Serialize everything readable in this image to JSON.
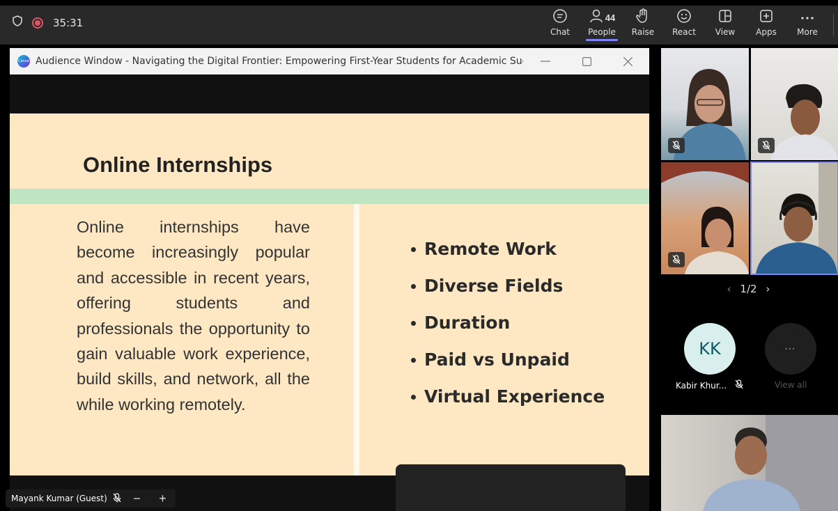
{
  "meeting": {
    "timer": "35:31"
  },
  "toolbar": {
    "chat_label": "Chat",
    "people_label": "People",
    "people_count": "44",
    "raise_label": "Raise",
    "react_label": "React",
    "view_label": "View",
    "apps_label": "Apps",
    "more_label": "More",
    "accent_color": "#7f85f5"
  },
  "audience_window": {
    "title": "Audience Window - Navigating the Digital Frontier: Empowering First-Year Students for Academic Succ...",
    "app_icon": "canva-icon"
  },
  "slide": {
    "title": "Online Internships",
    "paragraph": "Online internships have become increasingly popular and accessible in recent years, offering students and professionals the opportunity to gain valuable work experience, build skills, and network, all the while working remotely.",
    "bullets": [
      "Remote Work",
      "Diverse Fields",
      "Duration",
      "Paid vs Unpaid",
      "Virtual Experience"
    ],
    "background_color": "#fde8c3",
    "band_color": "#bfe5c2"
  },
  "presenter_tag": {
    "name": "Mayank Kumar (Guest)"
  },
  "gallery": {
    "page": "1/2",
    "participant_initials": "KK",
    "participant_name": "Kabir Khur...",
    "view_all_label": "View all",
    "more_glyph": "⋯"
  }
}
